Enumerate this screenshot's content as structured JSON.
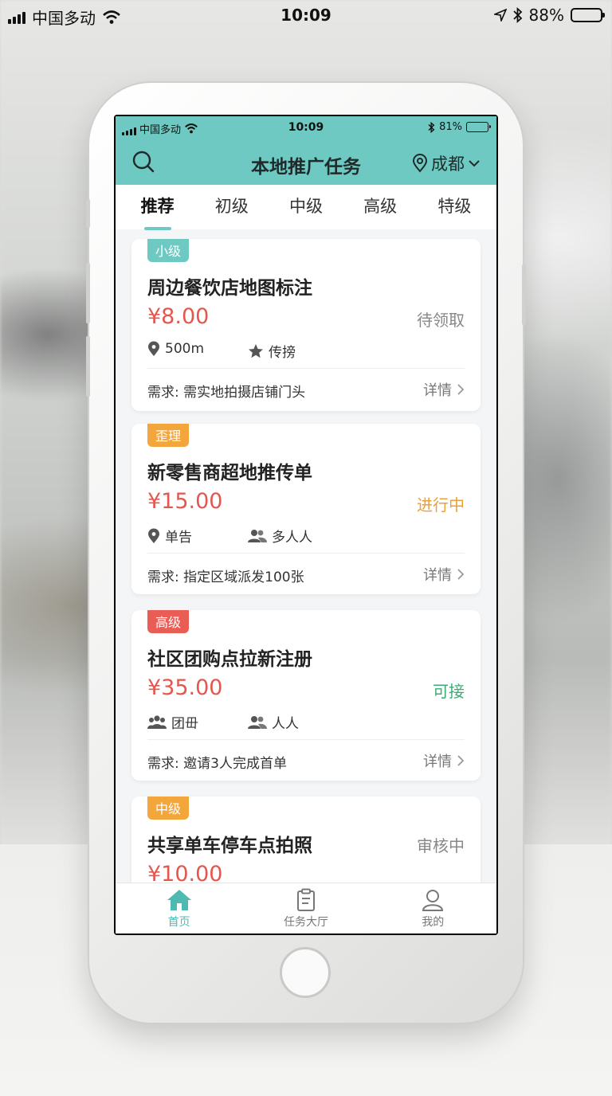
{
  "outer_status": {
    "carrier": "中国多动",
    "time": "10:09",
    "battery": "88%",
    "battery_level": 0.88
  },
  "inner_status": {
    "carrier": "中国多动",
    "time": "10:09",
    "battery": "81%",
    "battery_level": 0.81
  },
  "header": {
    "title": "本地推广任务",
    "city": "成都"
  },
  "tabs": [
    {
      "label": "推荐",
      "active": true
    },
    {
      "label": "初级"
    },
    {
      "label": "中级"
    },
    {
      "label": "高级"
    },
    {
      "label": "特级"
    }
  ],
  "cards": [
    {
      "tag": "小级",
      "title": "周边餐饮店地图标注",
      "price": "¥8.00",
      "status": "待领取",
      "meta1": "500m",
      "meta2": "传搒",
      "need": "需求: 需实地拍摄店铺门头",
      "detail": "详情"
    },
    {
      "tag": "歪理",
      "title": "新零售商超地推传单",
      "price": "¥15.00",
      "status": "进行中",
      "meta1": "单告",
      "meta2": "多人人",
      "need": "需求: 指定区域派发100张",
      "detail": "详情"
    },
    {
      "tag": "高级",
      "title": "社区团购点拉新注册",
      "price": "¥35.00",
      "status": "可接",
      "meta1": "团毌",
      "meta2": "人人",
      "need": "需求: 邀请3人完成首单",
      "detail": "详情"
    },
    {
      "tag": "中级",
      "title": "共享单车停车点拍照",
      "price": "¥10.00",
      "status": "审核中"
    }
  ],
  "tabbar": [
    {
      "label": "首页",
      "icon": "home-icon",
      "active": true
    },
    {
      "label": "任务大厅",
      "icon": "clipboard-icon"
    },
    {
      "label": "我的",
      "icon": "user-icon"
    }
  ],
  "colors": {
    "accent": "#6ec9c2",
    "price": "#e4574f",
    "tag_orange": "#f2a63c",
    "tag_red": "#ea5d55",
    "status_green": "#3aab73"
  }
}
